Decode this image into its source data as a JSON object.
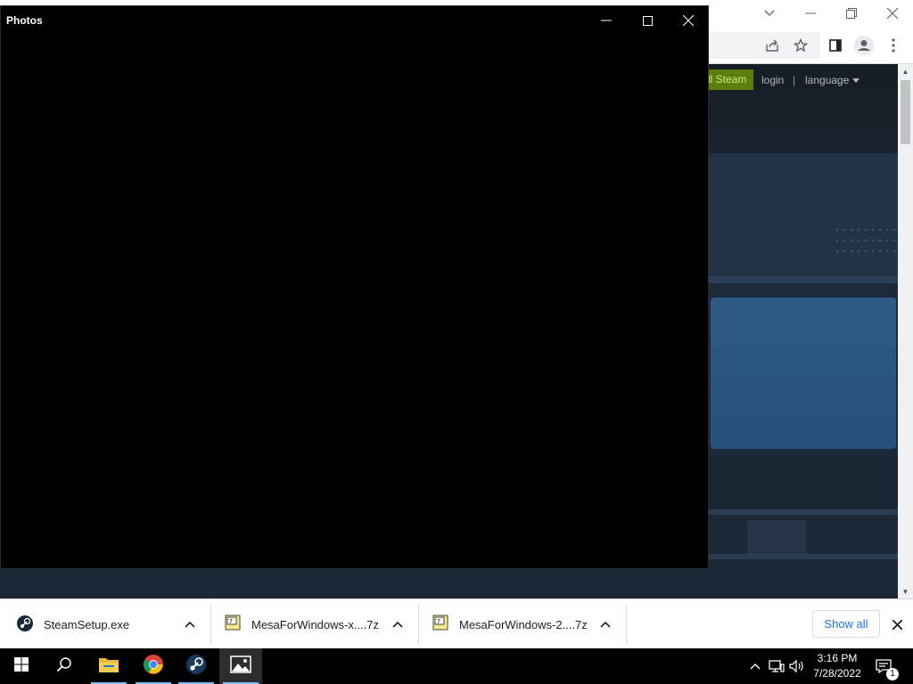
{
  "photos": {
    "title": "Photos",
    "buttons": [
      "minimize",
      "maximize",
      "close"
    ]
  },
  "steam": {
    "install_label": "Install Steam",
    "install_visible": "ll Steam",
    "login": "login",
    "separator": "|",
    "language": "language"
  },
  "downloads": {
    "items": [
      {
        "name": "SteamSetup.exe",
        "icon": "steam-icon"
      },
      {
        "name": "MesaForWindows-x....7z",
        "icon": "archive-7z-icon"
      },
      {
        "name": "MesaForWindows-2....7z",
        "icon": "archive-7z-icon"
      }
    ],
    "show_all": "Show all"
  },
  "taskbar": {
    "apps": [
      "start",
      "search",
      "file-explorer",
      "chrome",
      "steam",
      "photos"
    ],
    "active_app": "photos",
    "time": "3:16 PM",
    "date": "7/28/2022",
    "notification_count": "1"
  },
  "colors": {
    "steam_install_bg": "#5c7e10",
    "steam_bg": "#1b2838",
    "chrome_link": "#1a73e8",
    "taskbar_accent": "#76b9ed"
  }
}
